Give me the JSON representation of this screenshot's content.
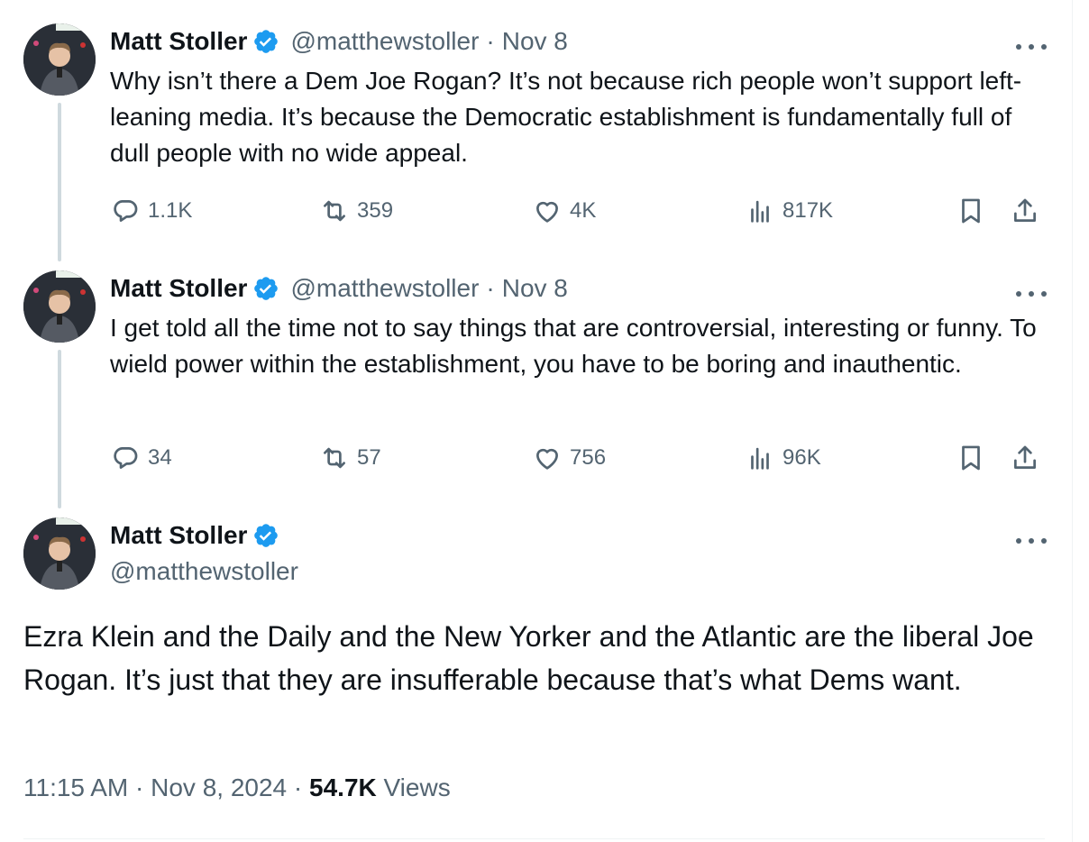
{
  "colors": {
    "text": "#0f1419",
    "secondary": "#536471",
    "verified": "#1d9bf0",
    "thread_line": "#cfd9de"
  },
  "tweets": [
    {
      "name": "Matt Stoller",
      "handle": "@matthewstoller",
      "sep": "·",
      "date": "Nov 8",
      "text": "Why isn’t there a Dem Joe Rogan? It’s not because rich people won’t support left-leaning media. It’s because the Democratic establishment is fundamentally full of dull people with no wide appeal.",
      "replies": "1.1K",
      "reposts": "359",
      "likes": "4K",
      "views": "817K"
    },
    {
      "name": "Matt Stoller",
      "handle": "@matthewstoller",
      "sep": "·",
      "date": "Nov 8",
      "text": "I get told all the time not to say things that are controversial, interesting or funny. To wield power within the establishment, you have to be boring and inauthentic.",
      "replies": "34",
      "reposts": "57",
      "likes": "756",
      "views": "96K"
    }
  ],
  "main": {
    "name": "Matt Stoller",
    "handle": "@matthewstoller",
    "text": "Ezra Klein and the Daily and the New Yorker and the Atlantic are the liberal Joe Rogan. It’s just that they are insufferable because that’s what Dems want.",
    "time": "11:15 AM",
    "sep": "·",
    "date": "Nov 8, 2024",
    "views_count": "54.7K",
    "views_label": "Views"
  },
  "icons": [
    "verified-badge-icon",
    "more-icon",
    "reply-icon",
    "repost-icon",
    "like-icon",
    "views-icon",
    "bookmark-icon",
    "share-icon"
  ]
}
